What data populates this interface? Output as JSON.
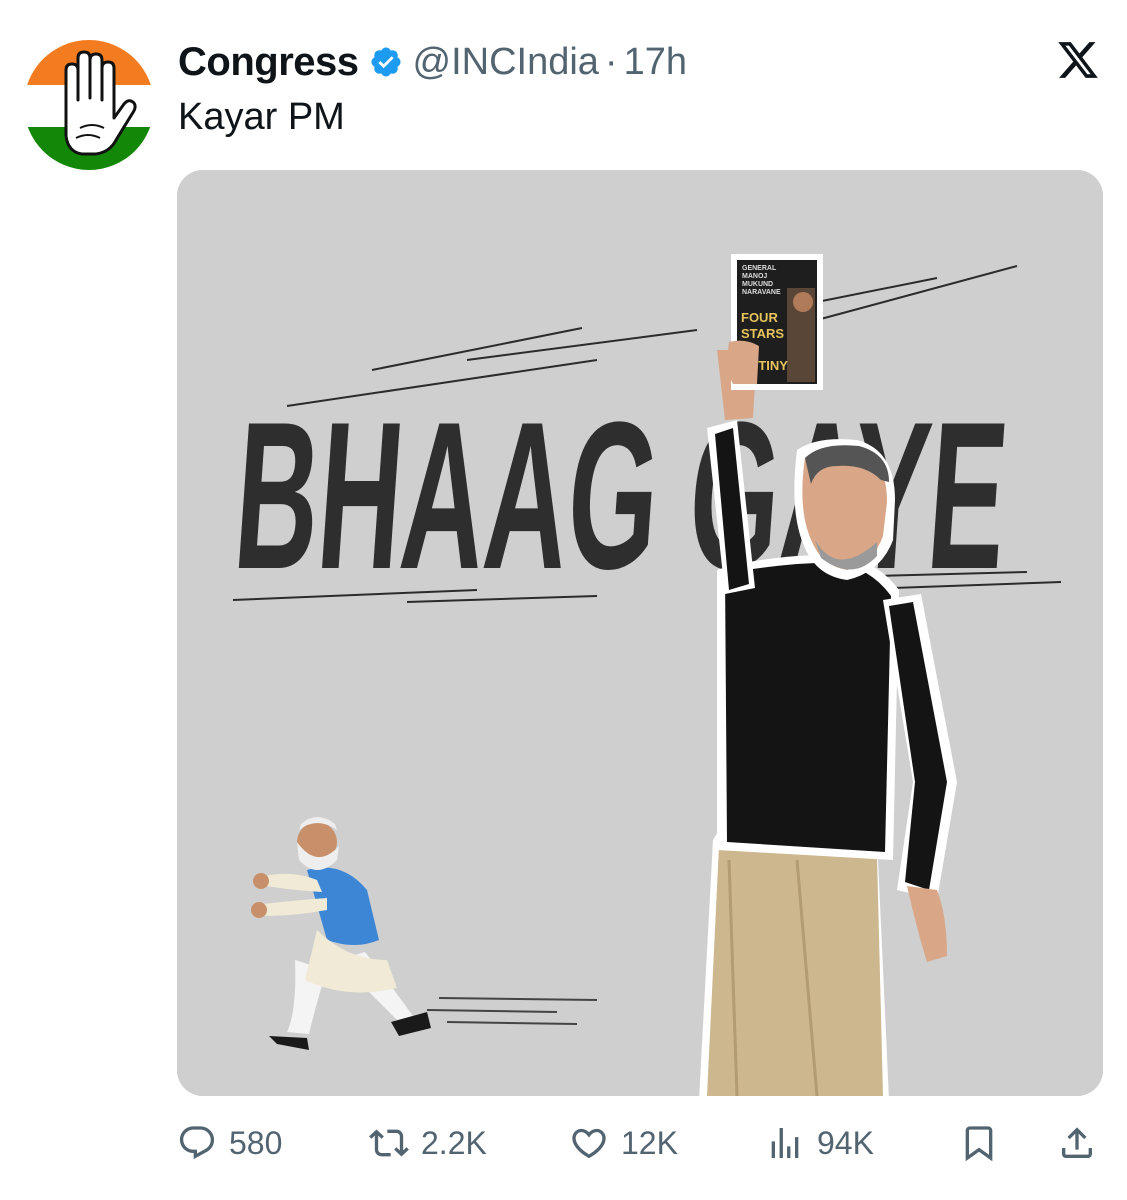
{
  "tweet": {
    "display_name": "Congress",
    "handle": "@INCIndia",
    "separator": "·",
    "time": "17h",
    "text": "Kayar PM",
    "avatar_icon": "congress-hand-logo-icon",
    "verified_icon": "verified-badge-icon",
    "platform_icon": "x-logo-icon"
  },
  "media": {
    "headline": "BHAAG GAYE",
    "book": {
      "author_lines": [
        "GENERAL",
        "MANOJ",
        "MUKUND",
        "NARAVANE"
      ],
      "title_lines": [
        "FOUR",
        "STARS",
        "ESTINY"
      ]
    }
  },
  "actions": {
    "reply": {
      "count": "580",
      "icon": "reply-icon"
    },
    "repost": {
      "count": "2.2K",
      "icon": "repost-icon"
    },
    "like": {
      "count": "12K",
      "icon": "heart-icon"
    },
    "views": {
      "count": "94K",
      "icon": "views-icon"
    },
    "bookmark": {
      "icon": "bookmark-icon"
    },
    "share": {
      "icon": "share-icon"
    }
  },
  "colors": {
    "text_primary": "#0f1419",
    "text_secondary": "#536471",
    "verified_blue": "#1d9bf0",
    "saffron": "#f47c20",
    "green": "#138808",
    "media_background": "#cfcfcf",
    "headline": "#2e2e2e"
  }
}
